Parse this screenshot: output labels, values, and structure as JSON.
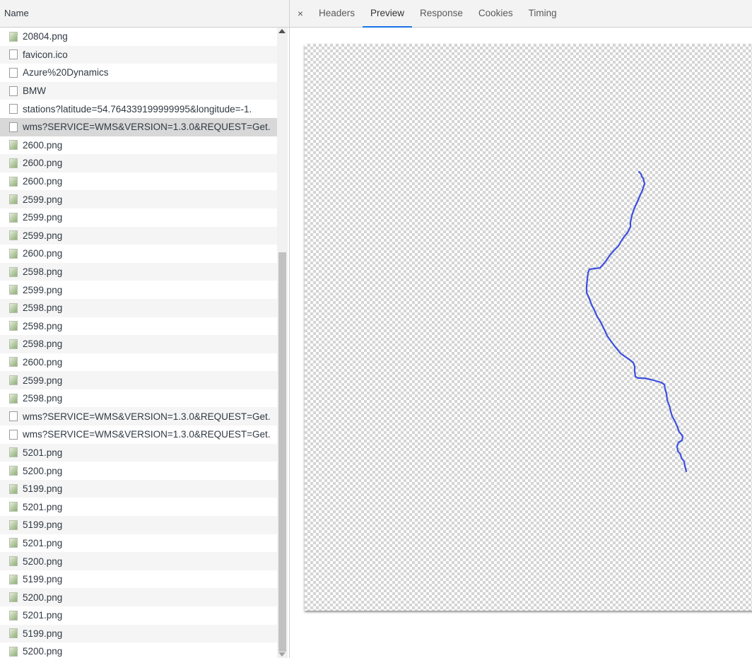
{
  "left_panel": {
    "column_header": "Name",
    "requests": [
      {
        "name": "20804.png",
        "type": "img"
      },
      {
        "name": "favicon.ico",
        "type": "doc"
      },
      {
        "name": "Azure%20Dynamics",
        "type": "doc"
      },
      {
        "name": "BMW",
        "type": "doc"
      },
      {
        "name": "stations?latitude=54.764339199999995&longitude=-1.",
        "type": "doc"
      },
      {
        "name": "wms?SERVICE=WMS&VERSION=1.3.0&REQUEST=Get.",
        "type": "doc",
        "selected": true
      },
      {
        "name": "2600.png",
        "type": "img"
      },
      {
        "name": "2600.png",
        "type": "img"
      },
      {
        "name": "2600.png",
        "type": "img"
      },
      {
        "name": "2599.png",
        "type": "img"
      },
      {
        "name": "2599.png",
        "type": "img"
      },
      {
        "name": "2599.png",
        "type": "img"
      },
      {
        "name": "2600.png",
        "type": "img"
      },
      {
        "name": "2598.png",
        "type": "img"
      },
      {
        "name": "2599.png",
        "type": "img"
      },
      {
        "name": "2598.png",
        "type": "img"
      },
      {
        "name": "2598.png",
        "type": "img"
      },
      {
        "name": "2598.png",
        "type": "img"
      },
      {
        "name": "2600.png",
        "type": "img"
      },
      {
        "name": "2599.png",
        "type": "img"
      },
      {
        "name": "2598.png",
        "type": "img"
      },
      {
        "name": "wms?SERVICE=WMS&VERSION=1.3.0&REQUEST=Get.",
        "type": "doc"
      },
      {
        "name": "wms?SERVICE=WMS&VERSION=1.3.0&REQUEST=Get.",
        "type": "doc"
      },
      {
        "name": "5201.png",
        "type": "img"
      },
      {
        "name": "5200.png",
        "type": "img"
      },
      {
        "name": "5199.png",
        "type": "img"
      },
      {
        "name": "5201.png",
        "type": "img"
      },
      {
        "name": "5199.png",
        "type": "img"
      },
      {
        "name": "5201.png",
        "type": "img"
      },
      {
        "name": "5200.png",
        "type": "img"
      },
      {
        "name": "5199.png",
        "type": "img"
      },
      {
        "name": "5200.png",
        "type": "img"
      },
      {
        "name": "5201.png",
        "type": "img"
      },
      {
        "name": "5199.png",
        "type": "img"
      },
      {
        "name": "5200.png",
        "type": "img"
      }
    ]
  },
  "detail_tabs": {
    "close_symbol": "×",
    "tabs": [
      "Headers",
      "Preview",
      "Response",
      "Cookies",
      "Timing"
    ],
    "active_tab": "Preview"
  },
  "preview": {
    "route_color": "#3d50e0"
  }
}
